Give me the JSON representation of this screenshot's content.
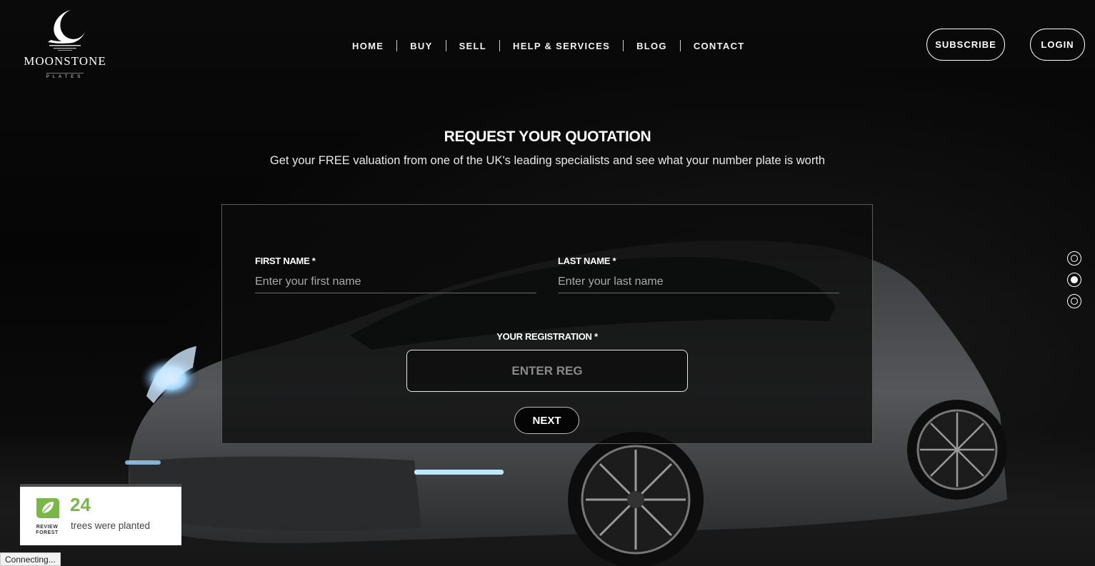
{
  "brand": {
    "name": "MOONSTONE",
    "tagline": "PLATES"
  },
  "nav": {
    "items": [
      {
        "label": "HOME"
      },
      {
        "label": "BUY"
      },
      {
        "label": "SELL"
      },
      {
        "label": "HELP & SERVICES"
      },
      {
        "label": "BLOG"
      },
      {
        "label": "CONTACT"
      }
    ]
  },
  "header_actions": {
    "subscribe_label": "SUBSCRIBE",
    "login_label": "LOGIN"
  },
  "hero": {
    "title": "REQUEST YOUR QUOTATION",
    "subtitle": "Get your FREE valuation from one of the UK's leading specialists and see what your number plate is worth"
  },
  "form": {
    "first_name": {
      "label": "FIRST NAME *",
      "placeholder": "Enter your first name",
      "value": ""
    },
    "last_name": {
      "label": "LAST NAME *",
      "placeholder": "Enter your last name",
      "value": ""
    },
    "registration": {
      "label": "YOUR REGISTRATION *",
      "placeholder": "ENTER REG",
      "value": ""
    },
    "next_label": "NEXT"
  },
  "slide_dots": {
    "count": 3,
    "active_index": 1
  },
  "review_forest": {
    "logo_line1": "REVIEW",
    "logo_line2": "FOREST",
    "count": "24",
    "text": "trees were planted",
    "accent": "#7ab648"
  },
  "status_bar": {
    "text": "Connecting..."
  }
}
